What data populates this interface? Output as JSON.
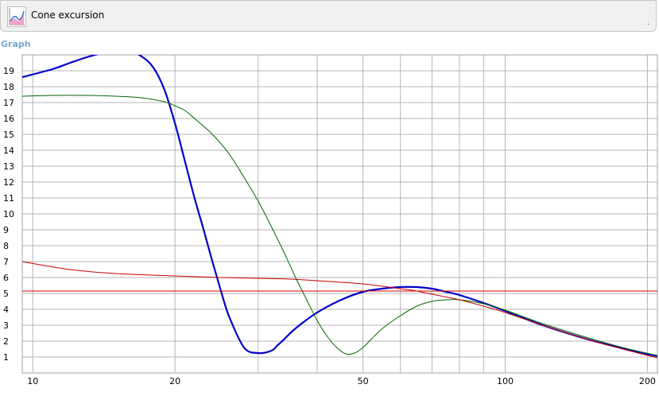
{
  "header": {
    "title": "Cone excursion",
    "icon": "chart-curve-icon",
    "trailing_mark": "."
  },
  "section": {
    "label": "Graph"
  },
  "chart_data": {
    "type": "line",
    "title": "",
    "xlabel": "",
    "ylabel": "",
    "x_scale": "log",
    "xlim": [
      9.5,
      210
    ],
    "ylim": [
      0,
      20
    ],
    "x_ticks": [
      10,
      20,
      50,
      100,
      200
    ],
    "y_ticks": [
      1,
      2,
      3,
      4,
      5,
      6,
      7,
      8,
      9,
      10,
      11,
      12,
      13,
      14,
      15,
      16,
      17,
      18,
      19
    ],
    "grid": true,
    "legend": "none",
    "series": [
      {
        "color": "#0000cc",
        "x": [
          9.5,
          11,
          12,
          13,
          14,
          15,
          16,
          17,
          18,
          19,
          20,
          21,
          22,
          23,
          24,
          25,
          26,
          28,
          30,
          32,
          33,
          34,
          36,
          40,
          45,
          50,
          55,
          60,
          65,
          70,
          75,
          80,
          90,
          100,
          120,
          150,
          180,
          210
        ],
        "y": [
          18.6,
          19.1,
          19.5,
          19.85,
          20.1,
          20.25,
          20.25,
          19.9,
          19.2,
          17.8,
          15.7,
          13.3,
          11.0,
          9.0,
          7.0,
          5.2,
          3.6,
          1.6,
          1.25,
          1.4,
          1.75,
          2.1,
          2.8,
          3.8,
          4.6,
          5.1,
          5.3,
          5.4,
          5.4,
          5.3,
          5.1,
          4.9,
          4.4,
          3.9,
          3.0,
          2.1,
          1.5,
          1.05
        ]
      },
      {
        "color": "#006600",
        "x": [
          9.5,
          11,
          13,
          15,
          17,
          19,
          20,
          21,
          22,
          24,
          26,
          28,
          30,
          32,
          34,
          36,
          38,
          40,
          42,
          44,
          46,
          48,
          50,
          52,
          55,
          60,
          65,
          70,
          75,
          80,
          90,
          100,
          120,
          150,
          180,
          210
        ],
        "y": [
          17.4,
          17.45,
          17.45,
          17.4,
          17.3,
          17.05,
          16.8,
          16.5,
          16.0,
          15.0,
          13.8,
          12.3,
          10.8,
          9.2,
          7.6,
          6.0,
          4.6,
          3.3,
          2.3,
          1.6,
          1.2,
          1.25,
          1.6,
          2.1,
          2.8,
          3.6,
          4.2,
          4.5,
          4.6,
          4.6,
          4.35,
          3.95,
          3.1,
          2.2,
          1.55,
          1.1
        ]
      },
      {
        "color": "#cc0000",
        "x": [
          9.5,
          12,
          15,
          20,
          25,
          30,
          35,
          40,
          45,
          50,
          55,
          60,
          65,
          70,
          80,
          90,
          100,
          120,
          150,
          180,
          210
        ],
        "y": [
          7.0,
          6.5,
          6.25,
          6.1,
          6.0,
          5.95,
          5.9,
          5.8,
          5.7,
          5.6,
          5.45,
          5.3,
          5.15,
          4.95,
          4.6,
          4.2,
          3.8,
          3.0,
          2.1,
          1.45,
          0.95
        ]
      },
      {
        "color": "#cc0000",
        "x": [
          9.5,
          210
        ],
        "y": [
          5.15,
          5.15
        ]
      }
    ]
  }
}
